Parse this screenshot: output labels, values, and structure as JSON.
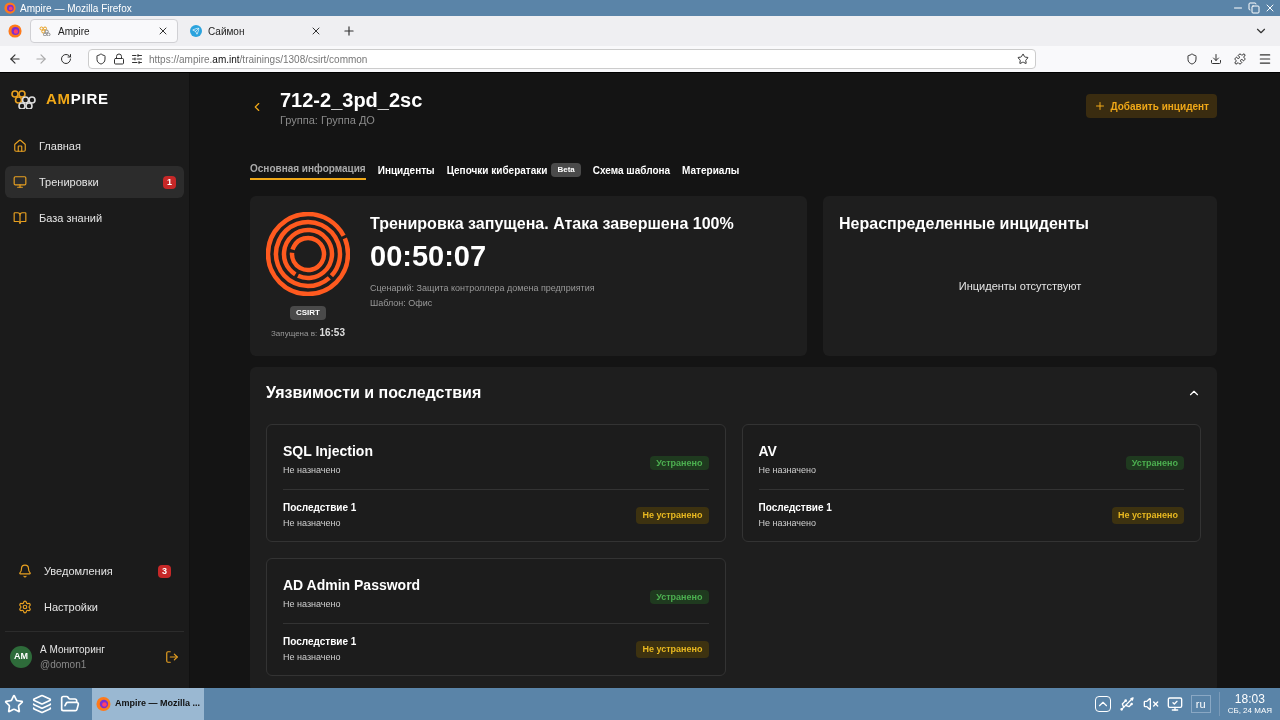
{
  "window": {
    "title": "Ampire — Mozilla Firefox"
  },
  "browser": {
    "tabs": [
      {
        "label": "Ampire",
        "selected": true,
        "kind": "ampire"
      },
      {
        "label": "Саймон",
        "selected": false,
        "kind": "telegram"
      }
    ],
    "url": {
      "prefix": "https://ampire.",
      "host": "am.int",
      "path": "/trainings/1308/csirt/common"
    }
  },
  "sidebar": {
    "logo": {
      "accent": "AM",
      "rest": "PIRE"
    },
    "items": [
      {
        "label": "Главная",
        "selected": false,
        "kind": "home"
      },
      {
        "label": "Тренировки",
        "selected": true,
        "kind": "training",
        "badge": "1"
      },
      {
        "label": "База знаний",
        "selected": false,
        "kind": "book"
      }
    ],
    "bottom_items": [
      {
        "label": "Уведомления",
        "selected": false,
        "kind": "bell",
        "badge": "3"
      },
      {
        "label": "Настройки",
        "selected": false,
        "kind": "gear"
      }
    ],
    "user": {
      "initials": "AM",
      "name": "А Мониторинг",
      "handle": "@domon1"
    }
  },
  "header": {
    "title": "712-2_3pd_2sc",
    "subtitle": "Группа: Группа ДО",
    "action": "Добавить инцидент"
  },
  "tabs": [
    {
      "label": "Основная информация",
      "selected": true
    },
    {
      "label": "Инциденты",
      "selected": false
    },
    {
      "label": "Цепочки кибератаки",
      "selected": false,
      "badge": "Beta"
    },
    {
      "label": "Схема шаблона",
      "selected": false
    },
    {
      "label": "Материалы",
      "selected": false
    }
  ],
  "status_card": {
    "team": "CSIRT",
    "started_label": "Запущена в:",
    "started_time": "16:53",
    "title": "Тренировка запущена. Атака завершена 100%",
    "timer": "00:50:07",
    "scenario": "Сценарий: Защита контроллера домена предприятия",
    "template": "Шаблон: Офис"
  },
  "unassigned": {
    "title": "Нераспределенные инциденты",
    "empty": "Инциденты отсутствуют"
  },
  "vulnerabilities": {
    "title": "Уязвимости и последствия",
    "expanded": true,
    "items": [
      {
        "name": "SQL Injection",
        "assignee": "Не назначено",
        "status": "Устранено",
        "resolved": true,
        "consequences": [
          {
            "name": "Последствие 1",
            "assignee": "Не назначено",
            "status": "Не устранено",
            "resolved": false
          }
        ]
      },
      {
        "name": "AV",
        "assignee": "Не назначено",
        "status": "Устранено",
        "resolved": true,
        "consequences": [
          {
            "name": "Последствие 1",
            "assignee": "Не назначено",
            "status": "Не устранено",
            "resolved": false
          }
        ]
      },
      {
        "name": "AD Admin Password",
        "assignee": "Не назначено",
        "status": "Устранено",
        "resolved": true,
        "consequences": [
          {
            "name": "Последствие 1",
            "assignee": "Не назначено",
            "status": "Не устранено",
            "resolved": false
          }
        ]
      }
    ]
  },
  "taskbar": {
    "task": "Ampire — Mozilla ...",
    "language": "ru",
    "time": "18:03",
    "date": "СБ, 24 МАЯ"
  }
}
